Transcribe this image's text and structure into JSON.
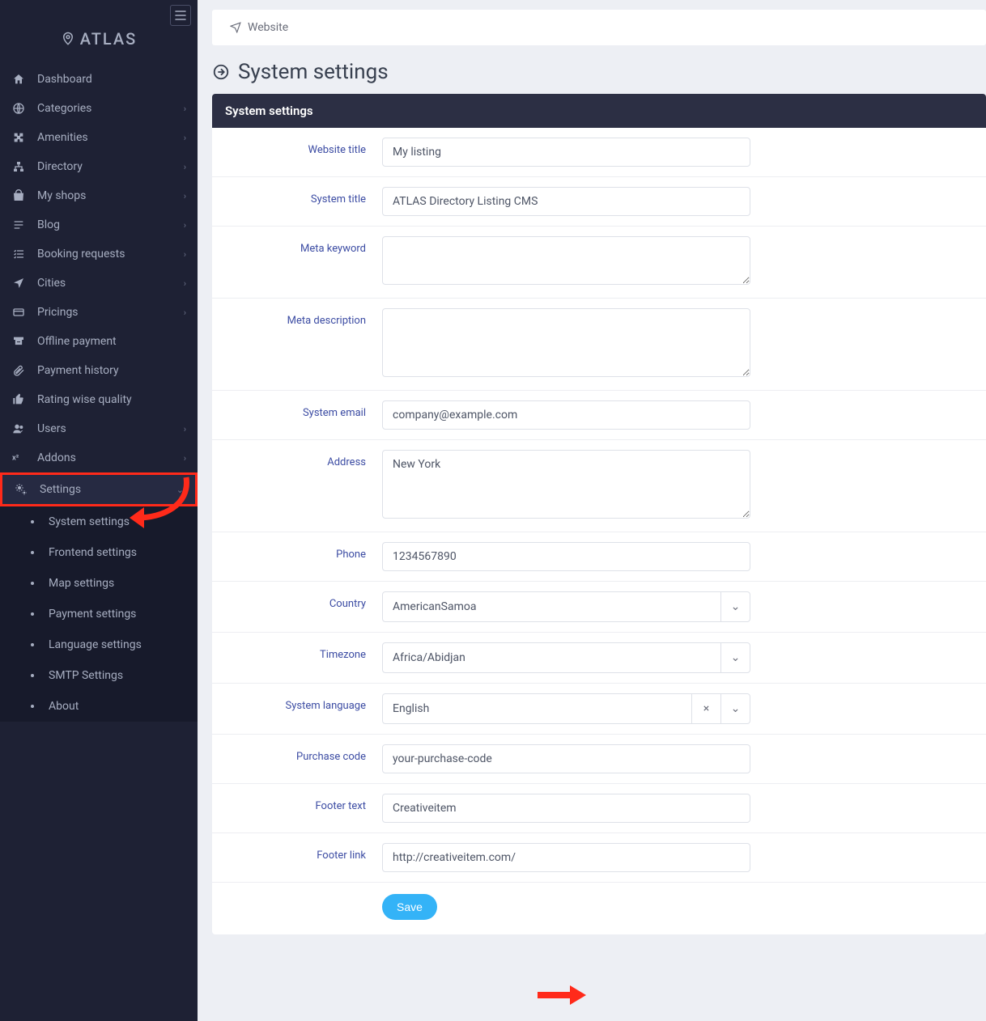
{
  "brand": {
    "name": "ATLAS"
  },
  "topbar": {
    "website": "Website"
  },
  "page": {
    "title": "System settings"
  },
  "panel": {
    "header": "System settings"
  },
  "sidebar": {
    "dashboard": "Dashboard",
    "categories": "Categories",
    "amenities": "Amenities",
    "directory": "Directory",
    "myshops": "My shops",
    "blog": "Blog",
    "booking": "Booking requests",
    "cities": "Cities",
    "pricings": "Pricings",
    "offline": "Offline payment",
    "payhist": "Payment history",
    "rating": "Rating wise quality",
    "users": "Users",
    "addons": "Addons",
    "settings": "Settings",
    "sub": {
      "system": "System settings",
      "frontend": "Frontend settings",
      "map": "Map settings",
      "payment": "Payment settings",
      "language": "Language settings",
      "smtp": "SMTP Settings",
      "about": "About"
    }
  },
  "form": {
    "labels": {
      "website_title": "Website title",
      "system_title": "System title",
      "meta_keyword": "Meta keyword",
      "meta_description": "Meta description",
      "system_email": "System email",
      "address": "Address",
      "phone": "Phone",
      "country": "Country",
      "timezone": "Timezone",
      "system_language": "System language",
      "purchase_code": "Purchase code",
      "footer_text": "Footer text",
      "footer_link": "Footer link"
    },
    "values": {
      "website_title": "My listing",
      "system_title": "ATLAS Directory Listing CMS",
      "meta_keyword": "",
      "meta_description": "",
      "system_email": "company@example.com",
      "address": "New York",
      "phone": "1234567890",
      "country": "AmericanSamoa",
      "timezone": "Africa/Abidjan",
      "system_language": "English",
      "purchase_code": "your-purchase-code",
      "footer_text": "Creativeitem",
      "footer_link": "http://creativeitem.com/"
    },
    "save": "Save"
  }
}
